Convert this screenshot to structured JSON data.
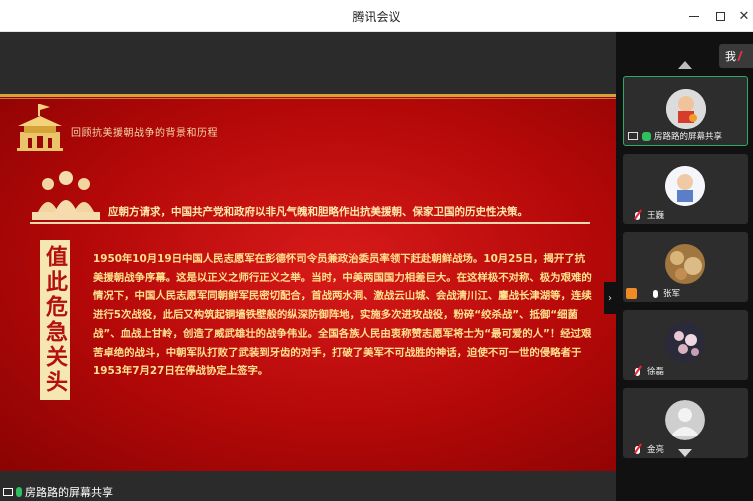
{
  "window": {
    "title": "腾讯会议"
  },
  "slide": {
    "subtitle": "回顾抗美援朝战争的背景和历程",
    "headline": "应朝方请求，中国共产党和政府以非凡气魄和胆略作出抗美援朝、保家卫国的历史性决策。",
    "vertical_title": "值此危急关头",
    "body": "1950年10月19日中国人民志愿军在彭德怀司令员兼政治委员率领下赶赴朝鲜战场。10月25日，揭开了抗美援朝战争序幕。这是以正义之师行正义之举。当时，中美两国国力相差巨大。在这样极不对称、极为艰难的情况下，中国人民志愿军同朝鲜军民密切配合，首战两水洞、激战云山城、会战清川江、鏖战长津湖等，连续进行5次战役，此后又构筑起铜墙铁壁般的纵深防御阵地，实施多次进攻战役，粉碎“绞杀战”、抵御“细菌战”、血战上甘岭，创造了威武雄壮的战争伟业。全国各族人民由衷称赞志愿军将士为“最可爱的人”！经过艰苦卓绝的战斗，中朝军队打败了武装到牙齿的对手，打破了美军不可战胜的神话，迫使不可一世的侵略者于1953年7月27日在停战协定上签字。"
  },
  "share_status": {
    "label": "房路路的屏幕共享"
  },
  "panel": {
    "me_label": "我",
    "participants": [
      {
        "name": "房路路的屏幕共享",
        "avatar": "robot",
        "active": true,
        "mic": "on",
        "screen": true
      },
      {
        "name": "王巍",
        "avatar": "child",
        "active": false,
        "mic": "muted"
      },
      {
        "name": "张军",
        "avatar": "bokeh",
        "active": false,
        "mic": "on",
        "orange": true
      },
      {
        "name": "徐磊",
        "avatar": "blossom",
        "active": false,
        "mic": "muted"
      },
      {
        "name": "金亮",
        "avatar": "default",
        "active": false,
        "mic": "muted"
      }
    ]
  },
  "colors": {
    "accent_green": "#2fbf5e",
    "slide_red": "#c40f0f",
    "slide_gold": "#ffe08c"
  }
}
